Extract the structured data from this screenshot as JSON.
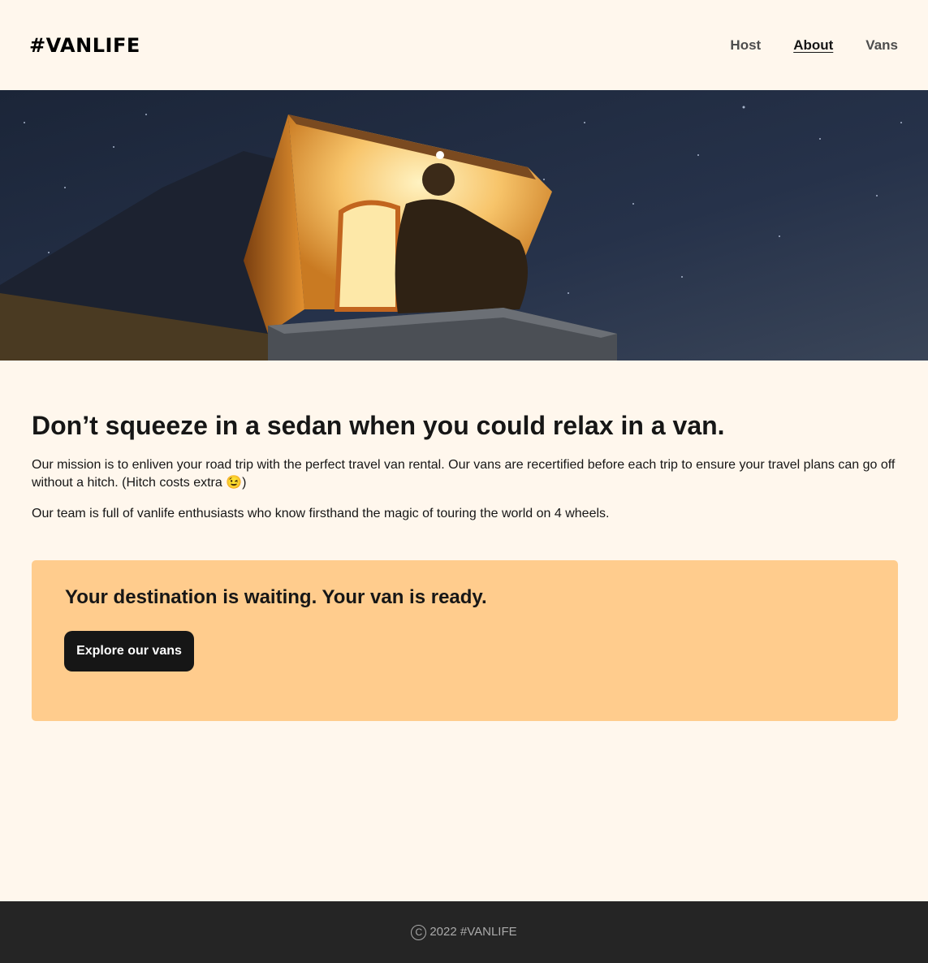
{
  "header": {
    "logo": "#VANLIFE",
    "nav": [
      {
        "label": "Host",
        "active": false
      },
      {
        "label": "About",
        "active": true
      },
      {
        "label": "Vans",
        "active": false
      }
    ]
  },
  "hero": {
    "image": "person-sitting-on-lit-rooftop-van-tent-at-night-photo"
  },
  "main": {
    "heading": "Don’t squeeze in a sedan when you could relax in a van.",
    "paragraph_1": "Our mission is to enliven your road trip with the perfect travel van rental. Our vans are recertified before each trip to ensure your travel plans can go off without a hitch. (Hitch costs extra 😉)",
    "paragraph_2": "Our team is full of vanlife enthusiasts who know firsthand the magic of touring the world on 4 wheels."
  },
  "cta": {
    "heading": "Your destination is waiting. Your van is ready.",
    "button_label": "Explore our vans"
  },
  "footer": {
    "copyright_symbol": "C",
    "text": "2022 #VANLIFE"
  },
  "colors": {
    "page_background": "#FFF7ED",
    "cta_background": "#FFCC8D",
    "button_background": "#161616",
    "footer_background": "#252525"
  }
}
